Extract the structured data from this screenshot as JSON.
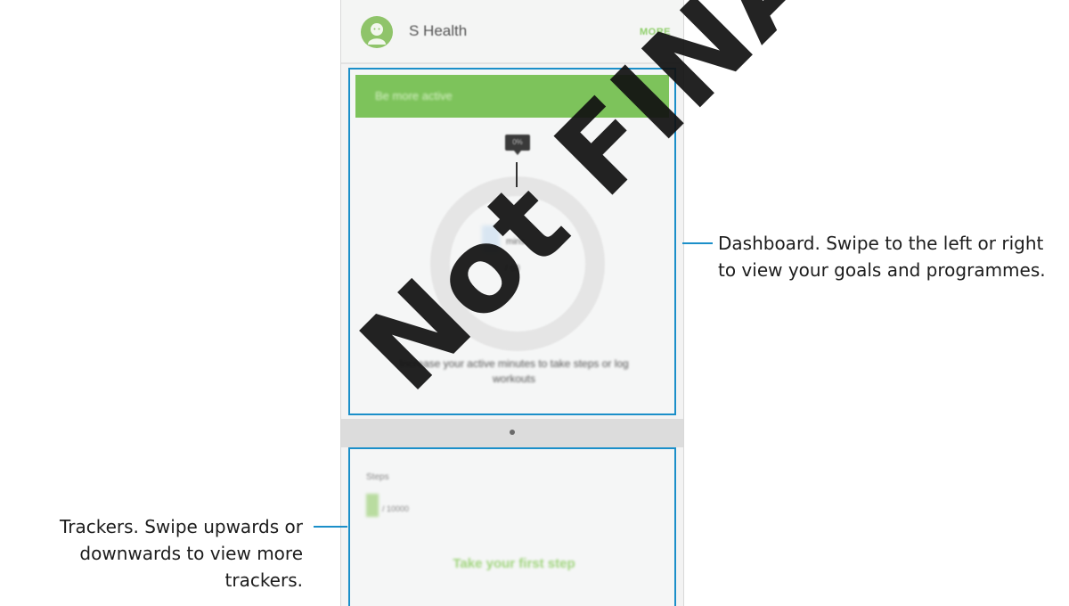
{
  "app": {
    "title": "S Health",
    "more_label": "MORE",
    "avatar_icon": "person-avatar-icon"
  },
  "dashboard": {
    "goal_title": "Be more active",
    "progress_label": "0%",
    "unit": "mins",
    "goal_target": "/ 60",
    "description": "Increase your active minutes to take steps or log workouts"
  },
  "pager": {
    "active_index": 0
  },
  "trackers": {
    "steps_label": "Steps",
    "steps_goal": "/ 10000",
    "cta": "Take your first step"
  },
  "callouts": {
    "dashboard": "Dashboard. Swipe to the left or right to view your goals and programmes.",
    "trackers": "Trackers. Swipe upwards or downwards to view more trackers."
  },
  "watermark": "Not FINAL",
  "colors": {
    "accent_green": "#7dc35b",
    "callout_blue": "#1b8fc9"
  }
}
